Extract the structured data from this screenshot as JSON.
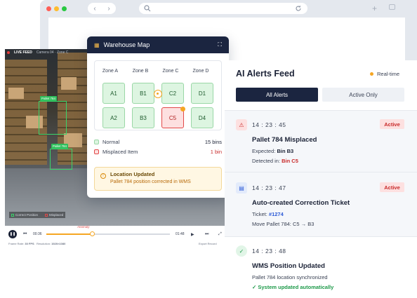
{
  "browser": {
    "back_glyph": "‹",
    "forward_glyph": "›",
    "search_icon": "search-icon",
    "reload_icon": "reload-icon",
    "new_tab_glyph": "+"
  },
  "video": {
    "live_label": "LIVE FEED",
    "camera_label": "Camera 04 · Zone C",
    "detections": [
      "Pallet 784",
      "Pallet 784"
    ],
    "legend": {
      "correct": "Correct Position",
      "misplaced": "Misplaced"
    },
    "controls": {
      "time_current": "00:36",
      "time_total": "01:48",
      "progress": 0.37,
      "anomaly_label": "Anomaly",
      "frame_rate_label": "Frame Rate:",
      "frame_rate_value": "30 FPS",
      "resolution_label": "Resolution:",
      "resolution_value": "1920×1080",
      "export_label": "Export Record"
    }
  },
  "map": {
    "title": "Warehouse Map",
    "zones": [
      "Zone A",
      "Zone B",
      "Zone C",
      "Zone D"
    ],
    "bins": [
      {
        "label": "A1",
        "status": "normal"
      },
      {
        "label": "B1",
        "status": "normal"
      },
      {
        "label": "C2",
        "status": "normal"
      },
      {
        "label": "D1",
        "status": "normal"
      },
      {
        "label": "A2",
        "status": "normal"
      },
      {
        "label": "B3",
        "status": "normal"
      },
      {
        "label": "C5",
        "status": "misplaced"
      },
      {
        "label": "D4",
        "status": "normal"
      }
    ],
    "legend": [
      {
        "label": "Normal",
        "value": "15 bins",
        "color": "#ddf5e1"
      },
      {
        "label": "Misplaced Item",
        "value": "1 bin",
        "color": "#fde0e0"
      }
    ],
    "notice": {
      "title": "Location Updated",
      "text": "Pallet 784 position corrected in WMS"
    }
  },
  "alerts": {
    "title": "AI Alerts Feed",
    "realtime_label": "Real-time",
    "tabs": [
      "All Alerts",
      "Active Only"
    ],
    "items": [
      {
        "time": "14 : 23 : 45",
        "badge": "Active",
        "title": "Pallet 784 Misplaced",
        "line1_prefix": "Expected: ",
        "line1_value": "Bin B3",
        "line2_prefix": "Detected in: ",
        "line2_value": "Bin C5",
        "icon": "warning-icon"
      },
      {
        "time": "14 : 23 : 47",
        "badge": "Active",
        "title": "Auto-created Correction Ticket",
        "line1_prefix": "Ticket: ",
        "line1_value": "#1274",
        "line2_prefix": "Move Pallet 784: C5 → B3",
        "icon": "ticket-icon"
      },
      {
        "time": "14 : 23 : 48",
        "title": "WMS Position Updated",
        "line1_prefix": "Pallet 784 location synchronized",
        "line2_prefix": "✓ System updated automatically",
        "icon": "check-circle-icon"
      }
    ]
  }
}
